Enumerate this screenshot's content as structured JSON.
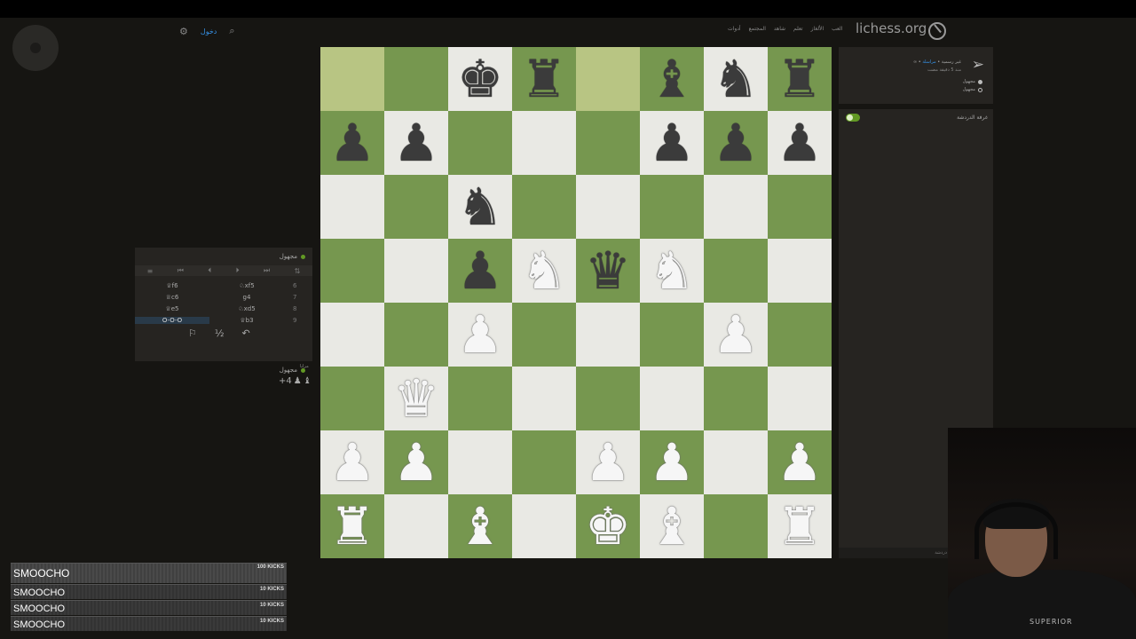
{
  "site": {
    "name": "lichess.org",
    "nav_links": [
      "العب",
      "الألغاز",
      "تعلم",
      "شاهد",
      "المجتمع",
      "أدوات"
    ],
    "signin": "دخول",
    "icons": [
      "gear-icon",
      "search-icon"
    ]
  },
  "board": {
    "orientation": "white",
    "ranks": [
      [
        "",
        "",
        "bk",
        "br",
        "",
        "bb",
        "bn",
        "br"
      ],
      [
        "bp",
        "bp",
        "",
        "",
        "",
        "bp",
        "bp",
        "bp"
      ],
      [
        "",
        "",
        "bn",
        "",
        "",
        "",
        "",
        ""
      ],
      [
        "",
        "",
        "bp",
        "wn",
        "bq",
        "wn",
        "",
        ""
      ],
      [
        "",
        "",
        "wp",
        "",
        "",
        "",
        "wp",
        ""
      ],
      [
        "",
        "wq",
        "",
        "",
        "",
        "",
        "",
        ""
      ],
      [
        "wp",
        "wp",
        "",
        "",
        "wp",
        "wp",
        "",
        "wp"
      ],
      [
        "wr",
        "",
        "wb",
        "",
        "wk",
        "wb",
        "",
        "wr"
      ]
    ],
    "highlight": [
      [
        0,
        0
      ],
      [
        0,
        4
      ]
    ]
  },
  "game": {
    "top_player": "مجهول",
    "bottom_player": "مجهول",
    "moves": [
      {
        "num": "6",
        "white": "♘xf5",
        "black": "♕f6"
      },
      {
        "num": "7",
        "white": "g4",
        "black": "♕c6"
      },
      {
        "num": "8",
        "white": "♘xd5",
        "black": "♕e5"
      },
      {
        "num": "9",
        "white": "♕b3",
        "black": "O-O-O",
        "current": "black"
      }
    ],
    "material_label": "مزايا",
    "material_diff": "+4"
  },
  "invite": {
    "line1_prefix": "∞ • غير رسمية •",
    "line1_link": "مراسلة",
    "line2": "منذ 5 دقيقة مضت",
    "opt_white": "مجهول",
    "opt_black": "مجهول"
  },
  "chat": {
    "title": "غرفة الدردشة",
    "input_placeholder": "دردشة"
  },
  "webcam": {
    "shirt_text": "SUPERIOR"
  },
  "kicks": [
    {
      "name": "SMOOCHO",
      "amount": "100 KICKS"
    },
    {
      "name": "SMOOCHO",
      "amount": "10 KICKS"
    },
    {
      "name": "SMOOCHO",
      "amount": "10 KICKS"
    },
    {
      "name": "SMOOCHO",
      "amount": "10 KICKS"
    }
  ]
}
